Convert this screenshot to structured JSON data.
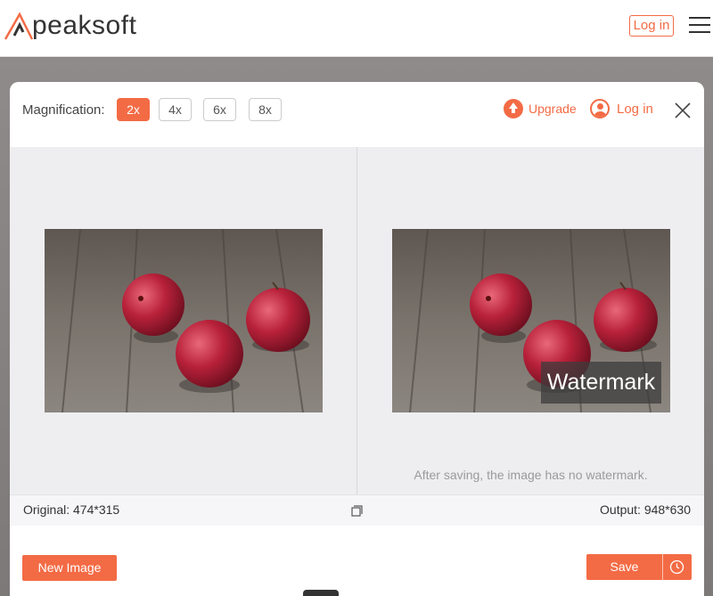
{
  "header": {
    "brand": "peaksoft",
    "login_label": "Log in"
  },
  "toolbar": {
    "magnification_label": "Magnification:",
    "magnifications": [
      "2x",
      "4x",
      "6x",
      "8x"
    ],
    "selected_magnification": "2x",
    "upgrade_label": "Upgrade",
    "login_label": "Log in"
  },
  "preview": {
    "watermark_text": "Watermark",
    "note": "After saving, the image has no watermark."
  },
  "info": {
    "original": "Original: 474*315",
    "output": "Output: 948*630"
  },
  "footer": {
    "new_image_label": "New Image",
    "save_label": "Save"
  },
  "colors": {
    "accent": "#f36b45",
    "panel_bg": "#eeeef1"
  },
  "icons": [
    "peaksoft-logo-icon",
    "hamburger-menu-icon",
    "upgrade-arrow-icon",
    "user-icon",
    "close-icon",
    "compare-icon",
    "history-clock-icon"
  ]
}
